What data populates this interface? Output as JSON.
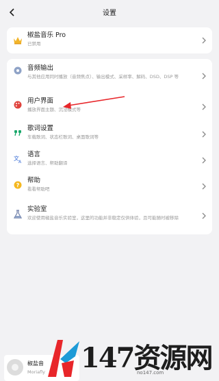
{
  "header": {
    "title": "设置"
  },
  "pro": {
    "label": "椒盐音乐 Pro",
    "sub": "已禁用"
  },
  "settings": [
    {
      "label": "音频输出",
      "sub": "与其他应用同时播放（音频焦点）、输出模式、采样率、解码、DSD、DSP 等",
      "icon": "speaker-icon"
    },
    {
      "label": "用户界面",
      "sub": "播放界面主题、沉浸模式等",
      "icon": "palette-icon"
    },
    {
      "label": "歌词设置",
      "sub": "车载歌词、状态栏歌词、桌面歌词等",
      "icon": "quote-icon"
    },
    {
      "label": "语言",
      "sub": "选择语言、帮助翻译",
      "icon": "translate-icon"
    },
    {
      "label": "帮助",
      "sub": "看看帮助吧",
      "icon": "help-icon"
    },
    {
      "label": "实验室",
      "sub": "欢迎使用椒盐音乐实验室，这里的功能并非稳定仅供体验，且可能随时被移除",
      "icon": "flask-icon"
    }
  ],
  "player": {
    "title": "椒盐音",
    "artist": "Moriafly"
  },
  "watermark": {
    "text": "147资源网",
    "url": "no147.com"
  },
  "colors": {
    "arrow": "#e8262a",
    "pro_crown": "#f2b52a",
    "quote": "#1aa86b",
    "help": "#f5b820",
    "translate": "#3b6fd6",
    "palette": "#e0433d"
  }
}
